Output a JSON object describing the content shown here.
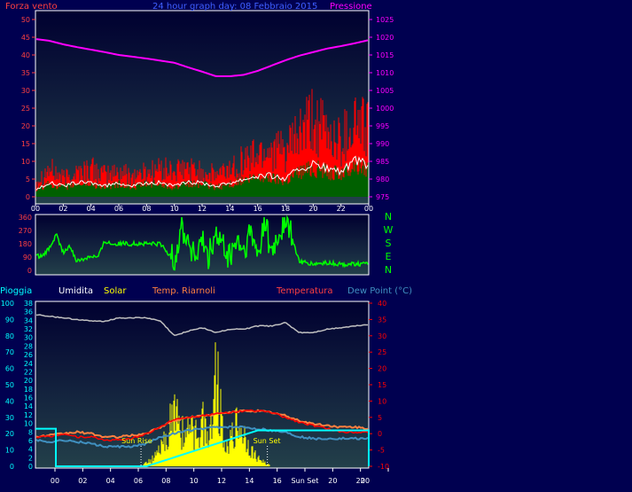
{
  "page": {
    "background": "#000050",
    "panel_background_top": "#000030",
    "panel_background_bottom": "#23404a",
    "frame_color": "#ffffff"
  },
  "header_top": {
    "left": "Forza vento",
    "center": "24 hour graph day: 08 Febbraio 2015",
    "right": "Pressione"
  },
  "header_bottom": {
    "pioggia": "Pioggia",
    "umidita": "Umidita",
    "solar": "Solar",
    "riarnoli": "Temp. Riarnoli",
    "temperatura": "Temperatura",
    "dewpoint": "Dew Point (°C)"
  },
  "x_ticks": [
    "00",
    "02",
    "04",
    "06",
    "08",
    "10",
    "12",
    "14",
    "16",
    "18",
    "20",
    "22",
    "00"
  ],
  "x_ticks_bottom": [
    "00",
    "02",
    "04",
    "06",
    "08",
    "10",
    "12",
    "14",
    "16",
    "Sun Set",
    "20",
    "22",
    "00"
  ],
  "compass": [
    "N",
    "W",
    "S",
    "E",
    "N"
  ],
  "annotations": {
    "sun_rise": "Sun Rise",
    "sun_set": "Sun Set"
  },
  "colors": {
    "wind_gust": "#ff0000",
    "wind_avg": "#ffffff",
    "wind_fill": "#006000",
    "pressure": "#ff00ff",
    "direction": "#00ff00",
    "rain": "#00ffff",
    "humidity": "#c0c0c0",
    "solar": "#ffff00",
    "riarnoli": "#ff8040",
    "temperature": "#ff0000",
    "dewpoint": "#4090c0",
    "left_axis": "#ff4040",
    "right_axis": "#ff00ff",
    "bottom_left_axis": "#00ffff",
    "bottom_left_axis2": "#00ffff",
    "bottom_right_axis": "#ff0000",
    "label_white": "#ffffff",
    "label_blue": "#4060ff",
    "label_yellow": "#ffff00",
    "label_orange": "#ff8040",
    "label_dewpoint": "#4090c0"
  },
  "chart_data": [
    {
      "type": "area",
      "panel": "wind_pressure",
      "x_ticks": [
        "00",
        "02",
        "04",
        "06",
        "08",
        "10",
        "12",
        "14",
        "16",
        "18",
        "20",
        "22",
        "00"
      ],
      "x_range_hours": [
        0,
        24
      ],
      "y_left_label": "Forza vento",
      "y_left_ticks": [
        0,
        5,
        10,
        15,
        20,
        25,
        30,
        35,
        40,
        45,
        50
      ],
      "ylim_left": [
        0,
        50
      ],
      "y_right_label": "Pressione",
      "y_right_ticks": [
        975,
        980,
        985,
        990,
        995,
        1000,
        1005,
        1010,
        1015,
        1020,
        1025
      ],
      "ylim_right": [
        975,
        1025
      ],
      "series": [
        {
          "name": "Pressione",
          "axis": "right",
          "x": [
            0,
            1,
            2,
            3,
            4,
            5,
            6,
            7,
            8,
            9,
            10,
            11,
            12,
            13,
            14,
            15,
            16,
            17,
            18,
            19,
            20,
            21,
            22,
            23,
            24
          ],
          "values": [
            1019.5,
            1019.0,
            1018.0,
            1017.2,
            1016.5,
            1015.8,
            1015.0,
            1014.5,
            1014.0,
            1013.4,
            1012.8,
            1011.5,
            1010.3,
            1009.0,
            1009.0,
            1009.4,
            1010.5,
            1012.0,
            1013.5,
            1014.8,
            1015.8,
            1016.8,
            1017.5,
            1018.3,
            1019.2
          ]
        },
        {
          "name": "Gust",
          "axis": "left",
          "x": [
            0,
            1,
            2,
            3,
            4,
            5,
            6,
            7,
            8,
            9,
            10,
            11,
            12,
            13,
            14,
            15,
            16,
            17,
            18,
            19,
            20,
            21,
            22,
            23,
            24
          ],
          "values": [
            5,
            9,
            6,
            8,
            9,
            7,
            8,
            7,
            8,
            9,
            8,
            9,
            8,
            7,
            9,
            12,
            14,
            16,
            14,
            20,
            24,
            20,
            18,
            25,
            22
          ]
        },
        {
          "name": "Average",
          "axis": "left",
          "x": [
            0,
            1,
            2,
            3,
            4,
            5,
            6,
            7,
            8,
            9,
            10,
            11,
            12,
            13,
            14,
            15,
            16,
            17,
            18,
            19,
            20,
            21,
            22,
            23,
            24
          ],
          "values": [
            2,
            4,
            3,
            4,
            4,
            3,
            4,
            3,
            4,
            4,
            3,
            4,
            4,
            3,
            4,
            5,
            6,
            6,
            5,
            8,
            9,
            8,
            7,
            10,
            9
          ]
        }
      ]
    },
    {
      "type": "line",
      "panel": "wind_direction",
      "x_ticks": [
        "00",
        "02",
        "04",
        "06",
        "08",
        "10",
        "12",
        "14",
        "16",
        "18",
        "20",
        "22",
        "00"
      ],
      "y_ticks": [
        0,
        90,
        180,
        270,
        360
      ],
      "ylim": [
        0,
        360
      ],
      "y_right_labels": [
        "N",
        "W",
        "S",
        "E",
        "N"
      ],
      "series": [
        {
          "name": "Direzione",
          "x": [
            0,
            0.5,
            1,
            1.5,
            2,
            2.5,
            3,
            3.5,
            4,
            4.5,
            5,
            5.5,
            6,
            7,
            8,
            9,
            10,
            10.5,
            11,
            11.5,
            12,
            12.5,
            13,
            13.5,
            14,
            14.5,
            15,
            15.5,
            16,
            16.5,
            17,
            18,
            19,
            20,
            21,
            22,
            23,
            24
          ],
          "values": [
            100,
            90,
            150,
            240,
            120,
            160,
            60,
            80,
            100,
            90,
            200,
            180,
            180,
            180,
            180,
            180,
            60,
            300,
            200,
            80,
            180,
            100,
            240,
            150,
            80,
            200,
            120,
            250,
            90,
            350,
            100,
            350,
            60,
            40,
            50,
            40,
            45,
            40
          ]
        }
      ]
    },
    {
      "type": "line",
      "panel": "weather",
      "x_ticks": [
        "00",
        "02",
        "04",
        "06",
        "08",
        "10",
        "12",
        "14",
        "16",
        "Sun Set",
        "20",
        "22",
        "00"
      ],
      "y_left_labels": [
        "Pioggia",
        "Umidita"
      ],
      "y_left_ticks": [
        0,
        10,
        20,
        30,
        40,
        50,
        60,
        70,
        80,
        90,
        100
      ],
      "y_left2_ticks": [
        0,
        2,
        4,
        6,
        8,
        10,
        12,
        14,
        16,
        18,
        20,
        22,
        24,
        26,
        28,
        30,
        32,
        34,
        36,
        38
      ],
      "ylim_left": [
        0,
        100
      ],
      "y_right_label": "Temperatura",
      "y_right_ticks": [
        -10,
        -5,
        0,
        5,
        10,
        15,
        20,
        25,
        30,
        35,
        40
      ],
      "ylim_right": [
        -10,
        40
      ],
      "annotations": [
        "Sun Rise",
        "Sun Set"
      ],
      "series": [
        {
          "name": "Umidita",
          "axis": "left",
          "x": [
            0,
            1,
            2,
            3,
            4,
            5,
            6,
            7,
            8,
            9,
            10,
            11,
            12,
            13,
            14,
            15,
            16,
            17,
            18,
            19,
            20,
            21,
            22,
            23,
            24
          ],
          "values": [
            93,
            92,
            91,
            90,
            89,
            89,
            91,
            91,
            91,
            89,
            80,
            83,
            85,
            82,
            84,
            84,
            86,
            86,
            88,
            82,
            82,
            84,
            85,
            86,
            87
          ]
        },
        {
          "name": "Solar",
          "axis": "left",
          "x": [
            0,
            7.5,
            8,
            8.5,
            9,
            9.5,
            10,
            10.5,
            11,
            11.5,
            12,
            12.5,
            13,
            13.5,
            14,
            14.5,
            15,
            15.5,
            16,
            17,
            24
          ],
          "values": [
            0,
            0,
            2,
            5,
            10,
            20,
            35,
            25,
            20,
            22,
            30,
            18,
            60,
            22,
            15,
            25,
            20,
            10,
            5,
            0,
            0
          ]
        },
        {
          "name": "Temp. Riarnoli",
          "axis": "right",
          "x": [
            0,
            1,
            2,
            3,
            4,
            5,
            6,
            7,
            8,
            9,
            10,
            11,
            12,
            13,
            14,
            15,
            16,
            17,
            18,
            19,
            20,
            21,
            22,
            23,
            24
          ],
          "values": [
            -1,
            -0.5,
            0,
            0.5,
            0,
            -1,
            -1,
            -0.5,
            0,
            2,
            4,
            5,
            5.5,
            6,
            6.5,
            7,
            7,
            6.5,
            5.5,
            4,
            3,
            2.5,
            2,
            2,
            1.5
          ]
        },
        {
          "name": "Temperatura",
          "axis": "right",
          "x": [
            0,
            1,
            2,
            3,
            4,
            5,
            6,
            7,
            8,
            9,
            10,
            11,
            12,
            13,
            14,
            15,
            16,
            17,
            18,
            19,
            20,
            21,
            22,
            23,
            24
          ],
          "values": [
            -1,
            -1,
            0,
            -1,
            -1,
            -2,
            -2,
            -1.5,
            0,
            2,
            4.5,
            5,
            5.5,
            6,
            6.5,
            7,
            7,
            6.5,
            5,
            3.5,
            2.5,
            1.5,
            0.5,
            0.5,
            0.5
          ]
        },
        {
          "name": "Dew Point",
          "axis": "right",
          "x": [
            0,
            1,
            2,
            3,
            4,
            5,
            6,
            7,
            8,
            9,
            10,
            11,
            12,
            13,
            14,
            15,
            16,
            17,
            18,
            19,
            20,
            21,
            22,
            23,
            24
          ],
          "values": [
            -2,
            -2.5,
            -2,
            -2.5,
            -3,
            -4,
            -4,
            -4,
            -3,
            -1,
            0,
            1,
            1.5,
            2,
            2,
            2,
            1.5,
            1,
            0.5,
            -1,
            -1.5,
            -1.5,
            -1.5,
            -1.5,
            -1.5
          ]
        },
        {
          "name": "Pioggia",
          "axis": "left",
          "x": [
            0,
            0.2,
            0.2,
            24
          ],
          "values": [
            23,
            23,
            0,
            0
          ]
        }
      ]
    }
  ]
}
